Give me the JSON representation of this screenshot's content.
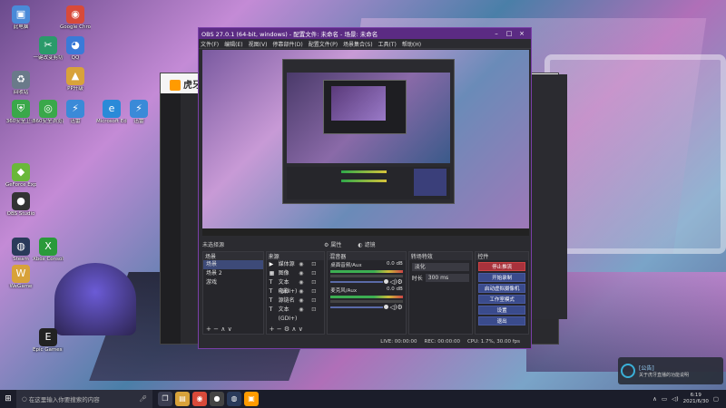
{
  "desktop": {
    "icons": [
      {
        "label": "此电脑",
        "glyph": "▣",
        "color": "#4a8ad8"
      },
      {
        "label": "Google Chrome",
        "glyph": "◉",
        "color": "#d84a3a"
      },
      {
        "label": "QQ",
        "glyph": "◕",
        "color": "#3a7ad8"
      },
      {
        "label": "一键改变剪切",
        "glyph": "✂",
        "color": "#2a9a6a"
      },
      {
        "label": "PP升级",
        "glyph": "▲",
        "color": "#d8a23a"
      },
      {
        "label": "回收站",
        "glyph": "♻",
        "color": "#6a7a8a"
      },
      {
        "label": "360安全卫士",
        "glyph": "⛨",
        "color": "#3aa84a"
      },
      {
        "label": "360安全浏览器",
        "glyph": "◎",
        "color": "#3aa84a"
      },
      {
        "label": "迅雷",
        "glyph": "⚡",
        "color": "#3a8ad8"
      },
      {
        "label": "Microsoft Edge",
        "glyph": "e",
        "color": "#2a8ad8"
      },
      {
        "label": "迅雷",
        "glyph": "⚡",
        "color": "#3a8ad8"
      },
      {
        "label": "GeForce Experience",
        "glyph": "◆",
        "color": "#6ab83a"
      },
      {
        "label": "Steam",
        "glyph": "◍",
        "color": "#2a3a5a"
      },
      {
        "label": "OBS Studio",
        "glyph": "●",
        "color": "#333333"
      },
      {
        "label": "Epic Games Launcher",
        "glyph": "E",
        "color": "#222222"
      },
      {
        "label": "WeGame",
        "glyph": "W",
        "color": "#d8a23a"
      },
      {
        "label": "Xbox Console Companion",
        "glyph": "X",
        "color": "#2a9a3a"
      }
    ]
  },
  "huya": {
    "logo_text": "虎牙"
  },
  "obs": {
    "title": "OBS 27.0.1 (64-bit, windows) - 配置文件: 未命名 - 场景: 未命名",
    "menu": [
      "文件(F)",
      "编辑(E)",
      "视图(V)",
      "停靠部件(D)",
      "配置文件(P)",
      "场景集合(S)",
      "工具(T)",
      "帮助(H)"
    ],
    "docks_header": {
      "left": "未选择源",
      "properties": "属性",
      "filters": "滤镜"
    },
    "scenes": {
      "title": "场景",
      "items": [
        "场景",
        "场景 2",
        "游戏"
      ],
      "selected_index": 0
    },
    "sources": {
      "title": "来源",
      "items": [
        {
          "icon": "▶",
          "name": "媒体源"
        },
        {
          "icon": "▦",
          "name": "图像"
        },
        {
          "icon": "T",
          "name": "文本 (GDI+)"
        },
        {
          "icon": "T",
          "name": "电影"
        },
        {
          "icon": "T",
          "name": "源链名"
        },
        {
          "icon": "T",
          "name": "文本 (GDI+)"
        }
      ]
    },
    "mixer": {
      "title": "混音器",
      "channels": [
        {
          "name": "桌面音频/Aux",
          "db": "0.0 dB"
        },
        {
          "name": "麦克风/Aux",
          "db": "0.0 dB"
        }
      ]
    },
    "transitions": {
      "title": "转场特效",
      "selected": "淡化",
      "duration_label": "时长",
      "duration_value": "300 ms"
    },
    "controls": {
      "title": "控件",
      "buttons": [
        "停止推流",
        "开始录制",
        "启动虚拟摄像机",
        "工作室模式",
        "设置",
        "退出"
      ],
      "active_index": 0
    },
    "status": {
      "live": "LIVE: 00:00:00",
      "rec": "REC: 00:00:00",
      "cpu": "CPU: 1.7%, 30.00 fps"
    }
  },
  "toast": {
    "title": "[公告]",
    "body": "关于虎牙直播的功能说明"
  },
  "taskbar": {
    "search_placeholder": "在这里输入你要搜索的内容",
    "apps": [
      {
        "name": "task-view-icon",
        "glyph": "❐",
        "color": "#3a3d50"
      },
      {
        "name": "explorer-icon",
        "glyph": "▤",
        "color": "#d8a23a"
      },
      {
        "name": "chrome-icon",
        "glyph": "◉",
        "color": "#d84a3a"
      },
      {
        "name": "obs-icon",
        "glyph": "●",
        "color": "#444444"
      },
      {
        "name": "steam-icon",
        "glyph": "◍",
        "color": "#2a3a5a"
      },
      {
        "name": "huya-icon",
        "glyph": "▣",
        "color": "#ff9b00"
      }
    ],
    "time": "6:19",
    "date": "2021/6/30"
  }
}
